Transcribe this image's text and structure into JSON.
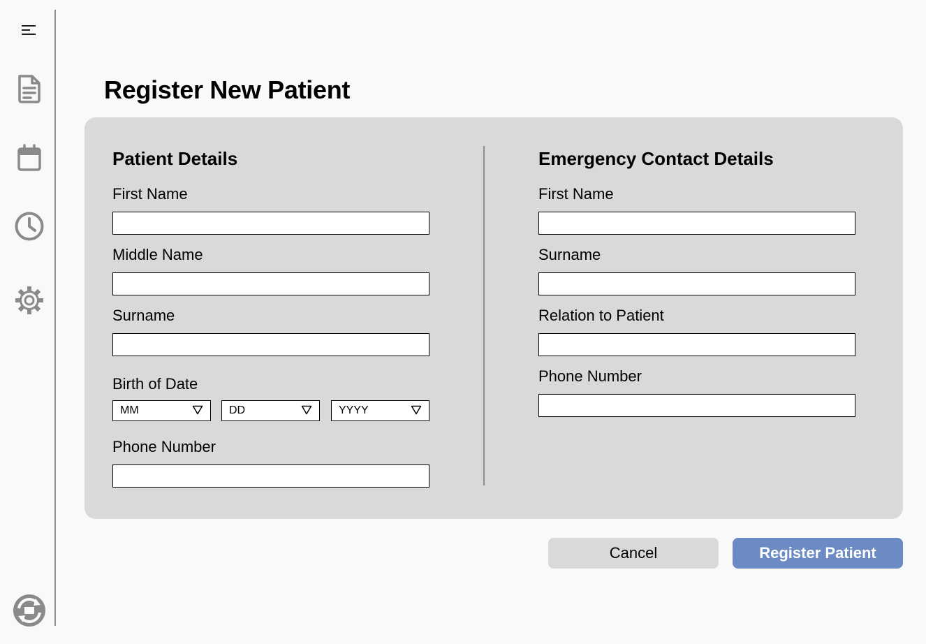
{
  "page": {
    "title": "Register New Patient"
  },
  "sidebar": {
    "items": [
      {
        "icon": "menu-icon"
      },
      {
        "icon": "document-icon"
      },
      {
        "icon": "calendar-icon"
      },
      {
        "icon": "clock-icon"
      },
      {
        "icon": "gear-icon"
      },
      {
        "icon": "sync-icon"
      }
    ]
  },
  "patient": {
    "title": "Patient Details",
    "first_name_label": "First Name",
    "first_name_value": "",
    "middle_name_label": "Middle Name",
    "middle_name_value": "",
    "surname_label": "Surname",
    "surname_value": "",
    "dob_label": "Birth of Date",
    "dob_month": "MM",
    "dob_day": "DD",
    "dob_year": "YYYY",
    "phone_label": "Phone Number",
    "phone_value": ""
  },
  "emergency": {
    "title": "Emergency Contact Details",
    "first_name_label": "First Name",
    "first_name_value": "",
    "surname_label": "Surname",
    "surname_value": "",
    "relation_label": "Relation to Patient",
    "relation_value": "",
    "phone_label": "Phone Number",
    "phone_value": ""
  },
  "actions": {
    "cancel_label": "Cancel",
    "register_label": "Register Patient"
  },
  "colors": {
    "background": "#f9f9f9",
    "card": "#d9d9d9",
    "primary": "#6c8bc4",
    "icon": "#8a8a8a"
  }
}
